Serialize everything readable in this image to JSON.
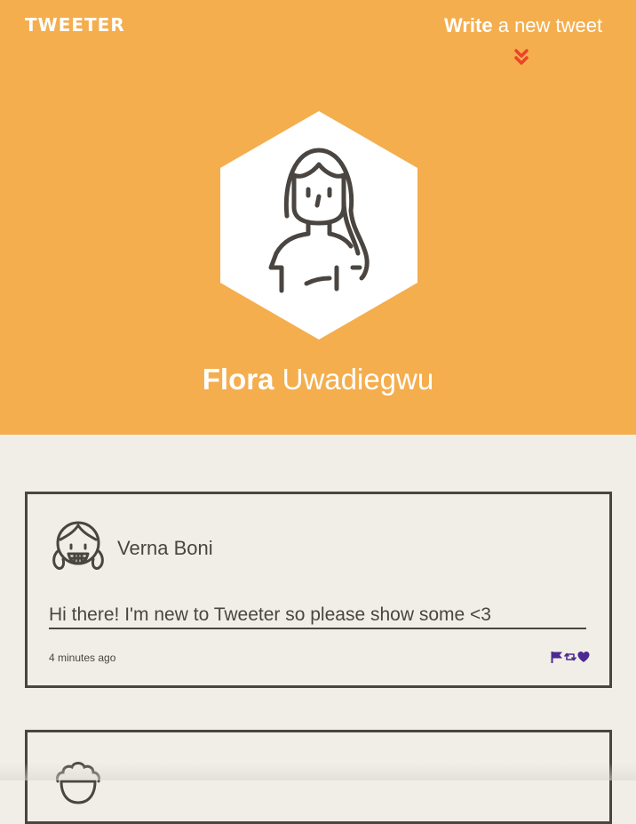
{
  "nav": {
    "logo": "TWEETER",
    "compose_bold": "Write",
    "compose_rest": " a new tweet",
    "compose_icon": "double-chevron-down-icon"
  },
  "profile": {
    "first_name": "Flora",
    "last_name": " Uwadiegwu",
    "avatar_icon": "female-user-avatar"
  },
  "tweets": [
    {
      "author": "Verna Boni",
      "text": "Hi there! I'm new to Tweeter so please show some <3",
      "time": "4 minutes ago",
      "avatar_icon": "smiling-girl-avatar",
      "actions": [
        "flag-icon",
        "retweet-icon",
        "heart-icon"
      ]
    },
    {
      "author": "",
      "avatar_icon": "curly-hair-avatar"
    }
  ],
  "colors": {
    "header_bg": "#f4ae4e",
    "page_bg": "#f1eee8",
    "text_dark": "#4a4540",
    "accent_red": "#e8452a",
    "action_purple": "#4b2a91"
  }
}
